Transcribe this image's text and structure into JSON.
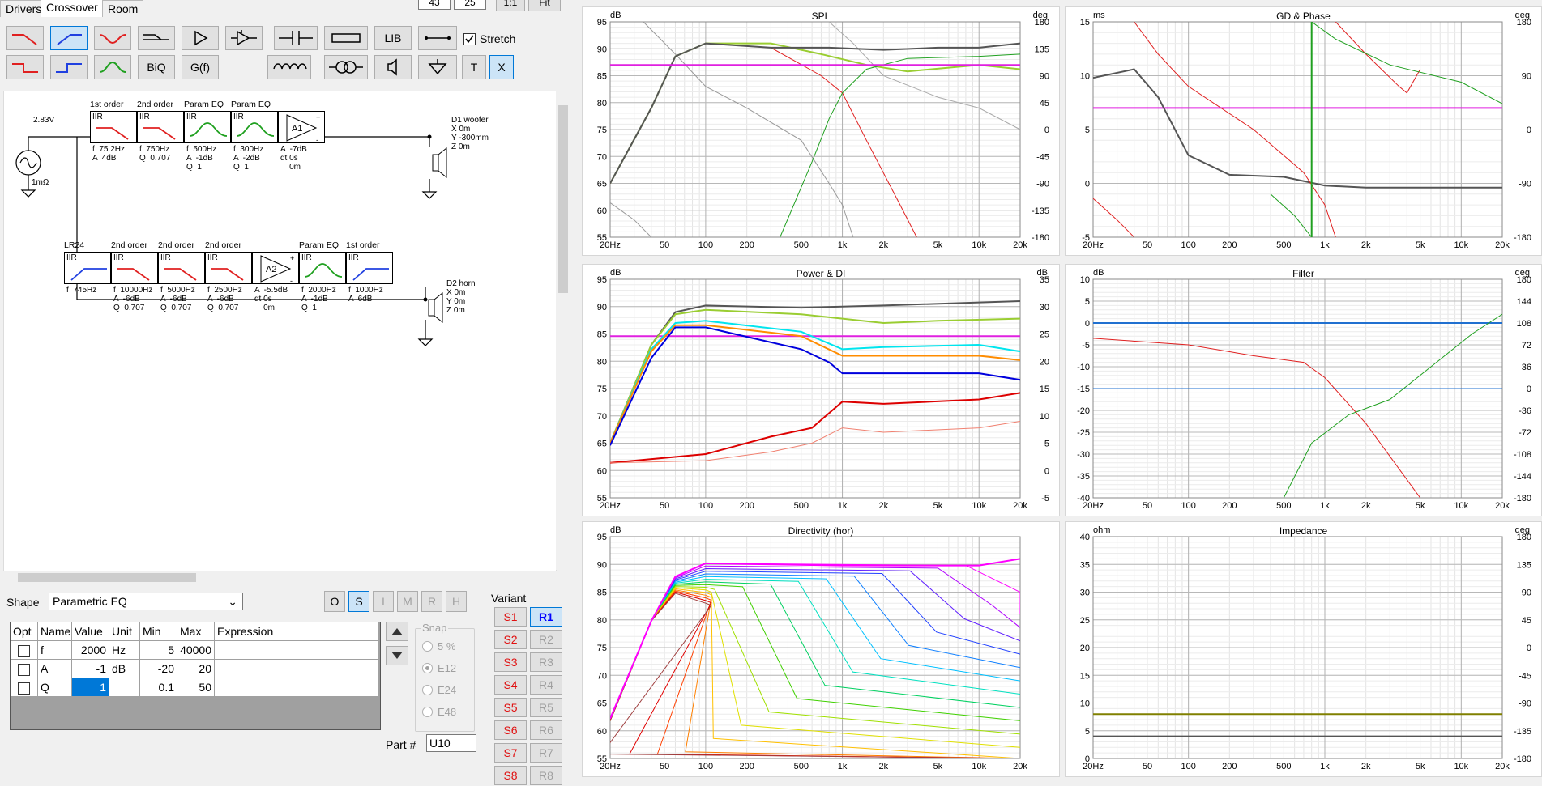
{
  "tabs": [
    "Drivers",
    "Crossover",
    "Room"
  ],
  "top_inputs": {
    "a": "43",
    "b": "25",
    "one_to_one": "1:1",
    "fit": "Fit"
  },
  "toolbar": {
    "biq": "BiQ",
    "gf": "G(f)",
    "lib": "LIB",
    "stretch": "Stretch",
    "t": "T",
    "x": "X"
  },
  "source": {
    "voltage": "2.83V",
    "resistance": "1mΩ"
  },
  "woofer_chain": [
    {
      "header": "1st order",
      "type": "IIR",
      "params": "f  75.2Hz\nA  4dB",
      "color": "#e02020"
    },
    {
      "header": "2nd order",
      "type": "IIR",
      "params": "f  750Hz\nQ  0.707",
      "color": "#e02020"
    },
    {
      "header": "Param EQ",
      "type": "IIR",
      "params": "f  500Hz\nA  -1dB\nQ  1",
      "color": "#20a020"
    },
    {
      "header": "Param EQ",
      "type": "IIR",
      "params": "f  300Hz\nA  -2dB\nQ  1",
      "color": "#20a020"
    },
    {
      "header": "",
      "type": "A1",
      "params": "A  -7dB\ndt 0s\n    0m",
      "color": "#20a020"
    }
  ],
  "horn_chain": [
    {
      "header": "LR24",
      "type": "IIR",
      "params": "f  745Hz",
      "color": "#2040e0"
    },
    {
      "header": "2nd order",
      "type": "IIR",
      "params": "f  10000Hz\nA  -6dB\nQ  0.707",
      "color": "#e02020"
    },
    {
      "header": "2nd order",
      "type": "IIR",
      "params": "f  5000Hz\nA  -6dB\nQ  0.707",
      "color": "#e02020"
    },
    {
      "header": "2nd order",
      "type": "IIR",
      "params": "f  2500Hz\nA  -6dB\nQ  0.707",
      "color": "#e02020"
    },
    {
      "header": "",
      "type": "A2",
      "params": "A  -5.5dB\ndt 0s\n    0m",
      "color": "#20a020"
    },
    {
      "header": "Param EQ",
      "type": "IIR",
      "params": "f  2000Hz\nA  -1dB\nQ  1",
      "color": "#20a020"
    },
    {
      "header": "1st order",
      "type": "IIR",
      "params": "f  1000Hz\nA  6dB",
      "color": "#2040e0"
    }
  ],
  "driver_d1": "D1 woofer\nX 0m\nY -300mm\nZ 0m",
  "driver_d2": "D2 horn\nX 0m\nY 0m\nZ 0m",
  "shape": {
    "label": "Shape",
    "value": "Parametric EQ"
  },
  "os_buttons": [
    "O",
    "S",
    "I",
    "M",
    "R",
    "H"
  ],
  "grid": {
    "headers": [
      "Opt",
      "Name",
      "Value",
      "Unit",
      "Min",
      "Max",
      "Expression"
    ],
    "rows": [
      {
        "name": "f",
        "value": "2000",
        "unit": "Hz",
        "min": "5",
        "max": "40000",
        "expr": ""
      },
      {
        "name": "A",
        "value": "-1",
        "unit": "dB",
        "min": "-20",
        "max": "20",
        "expr": ""
      },
      {
        "name": "Q",
        "value": "1",
        "unit": "",
        "min": "0.1",
        "max": "50",
        "expr": ""
      }
    ]
  },
  "snap": {
    "label": "Snap",
    "options": [
      "5 %",
      "E12",
      "E24",
      "E48"
    ],
    "selected": "E12"
  },
  "part": {
    "label": "Part #",
    "value": "U10"
  },
  "variant": {
    "label": "Variant",
    "s": [
      "S1",
      "S2",
      "S3",
      "S4",
      "S5",
      "S6",
      "S7",
      "S8"
    ],
    "r": [
      "R1",
      "R2",
      "R3",
      "R4",
      "R5",
      "R6",
      "R7",
      "R8"
    ],
    "selected": "R1"
  },
  "freq_ticks": [
    "20Hz",
    "50",
    "100",
    "200",
    "500",
    "1k",
    "2k",
    "5k",
    "10k",
    "20k"
  ],
  "charts": {
    "spl": {
      "title": "SPL",
      "unit_left": "dB",
      "unit_right": "deg",
      "y_left": [
        "95",
        "90",
        "85",
        "80",
        "75",
        "70",
        "65",
        "60",
        "55"
      ],
      "y_right": [
        "180",
        "135",
        "90",
        "45",
        "0",
        "-45",
        "-90",
        "-135",
        "-180"
      ]
    },
    "gd": {
      "title": "GD & Phase",
      "unit_left": "ms",
      "unit_right": "deg",
      "y_left": [
        "15",
        "10",
        "5",
        "0",
        "-5"
      ],
      "y_right": [
        "180",
        "90",
        "0",
        "-90",
        "-180"
      ]
    },
    "power": {
      "title": "Power & DI",
      "unit_left": "dB",
      "unit_right": "dB",
      "y_left": [
        "95",
        "90",
        "85",
        "80",
        "75",
        "70",
        "65",
        "60",
        "55"
      ],
      "y_right": [
        "35",
        "30",
        "25",
        "20",
        "15",
        "10",
        "5",
        "0",
        "-5"
      ]
    },
    "filter": {
      "title": "Filter",
      "unit_left": "dB",
      "unit_right": "deg",
      "y_left": [
        "10",
        "5",
        "0",
        "-5",
        "-10",
        "-15",
        "-20",
        "-25",
        "-30",
        "-35",
        "-40"
      ],
      "y_right": [
        "180",
        "144",
        "108",
        "72",
        "36",
        "0",
        "-36",
        "-72",
        "-108",
        "-144",
        "-180"
      ]
    },
    "directivity": {
      "title": "Directivity (hor)",
      "unit_left": "dB",
      "unit_right": "",
      "y_left": [
        "95",
        "90",
        "85",
        "80",
        "75",
        "70",
        "65",
        "60",
        "55"
      ]
    },
    "impedance": {
      "title": "Impedance",
      "unit_left": "ohm",
      "unit_right": "deg",
      "y_left": [
        "40",
        "35",
        "30",
        "25",
        "20",
        "15",
        "10",
        "5",
        "0"
      ],
      "y_right": [
        "180",
        "135",
        "90",
        "45",
        "0",
        "-45",
        "-90",
        "-135",
        "-180"
      ]
    }
  }
}
